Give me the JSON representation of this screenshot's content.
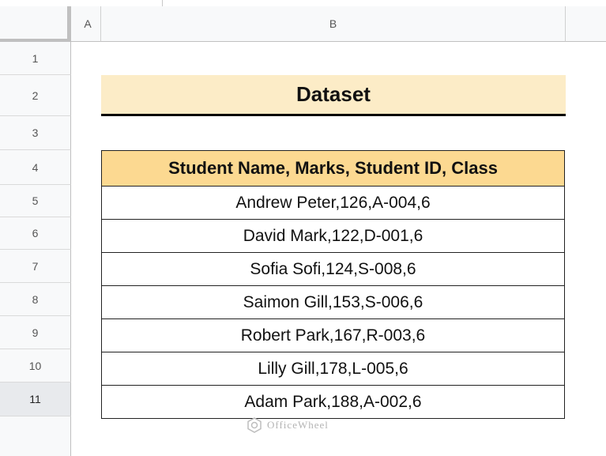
{
  "columns": [
    "A",
    "B"
  ],
  "rows": [
    "1",
    "2",
    "3",
    "4",
    "5",
    "6",
    "7",
    "8",
    "9",
    "10",
    "11"
  ],
  "selected_row": "11",
  "title": "Dataset",
  "table": {
    "header": "Student Name, Marks, Student ID, Class",
    "rows": [
      "Andrew Peter,126,A-004,6",
      "David Mark,122,D-001,6",
      "Sofia Sofi,124,S-008,6",
      "Saimon Gill,153,S-006,6",
      "Robert Park,167,R-003,6",
      "Lilly Gill,178,L-005,6",
      "Adam Park,188,A-002,6"
    ]
  },
  "watermark": "OfficeWheel",
  "colors": {
    "title_fill": "#fcecc7",
    "header_fill": "#fcd991",
    "grid_header_bg": "#f8f9fa"
  }
}
